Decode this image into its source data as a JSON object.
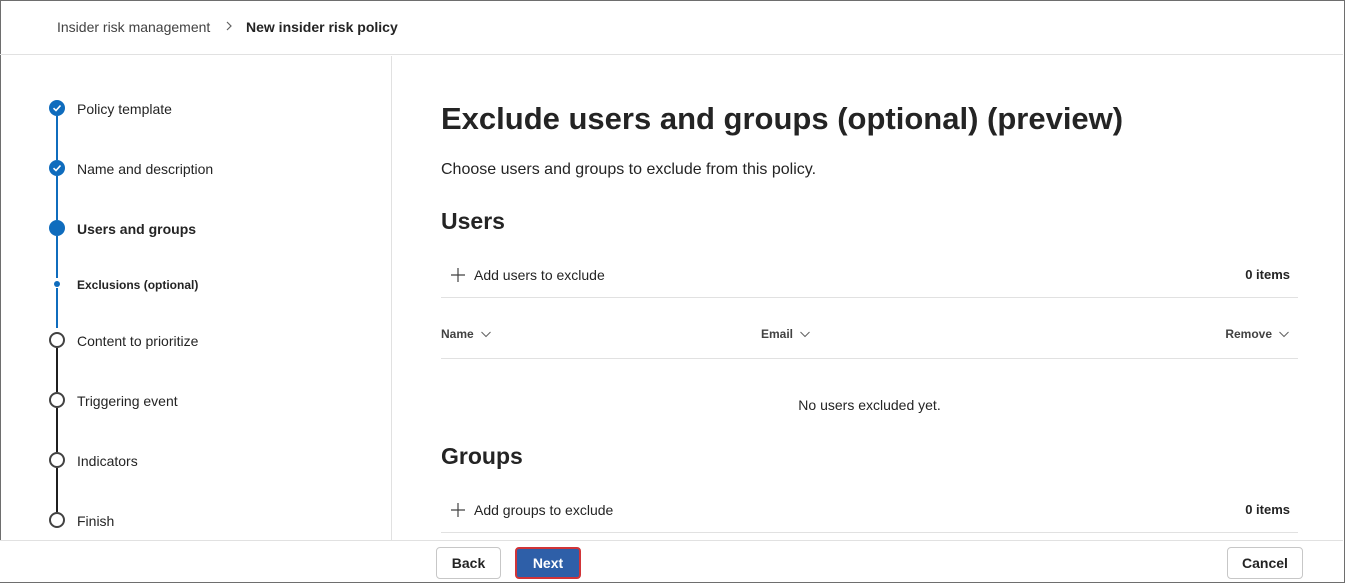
{
  "breadcrumb": {
    "root": "Insider risk management",
    "current": "New insider risk policy"
  },
  "steps": [
    {
      "label": "Policy template",
      "state": "completed"
    },
    {
      "label": "Name and description",
      "state": "completed"
    },
    {
      "label": "Users and groups",
      "state": "current"
    },
    {
      "label": "Exclusions (optional)",
      "state": "current-substep"
    },
    {
      "label": "Content to prioritize",
      "state": "not-started"
    },
    {
      "label": "Triggering event",
      "state": "not-started"
    },
    {
      "label": "Indicators",
      "state": "not-started"
    },
    {
      "label": "Finish",
      "state": "not-started"
    }
  ],
  "main": {
    "title": "Exclude users and groups (optional) (preview)",
    "description": "Choose users and groups to exclude from this policy.",
    "users": {
      "heading": "Users",
      "add_label": "Add users to exclude",
      "count": "0 items",
      "columns": [
        "Name",
        "Email",
        "Remove"
      ],
      "empty_message": "No users excluded yet."
    },
    "groups": {
      "heading": "Groups",
      "add_label": "Add groups to exclude",
      "count": "0 items"
    }
  },
  "footer": {
    "back": "Back",
    "next": "Next",
    "cancel": "Cancel"
  },
  "icons": {
    "breadcrumb_separator": "chevron-right-icon",
    "completed_step": "checkmark-icon",
    "add": "add-icon",
    "sort": "chevron-down-icon"
  },
  "colors": {
    "accent": "#0f6cbd",
    "primary_button": "#2e5fa8",
    "focus_outline": "#d13438"
  }
}
